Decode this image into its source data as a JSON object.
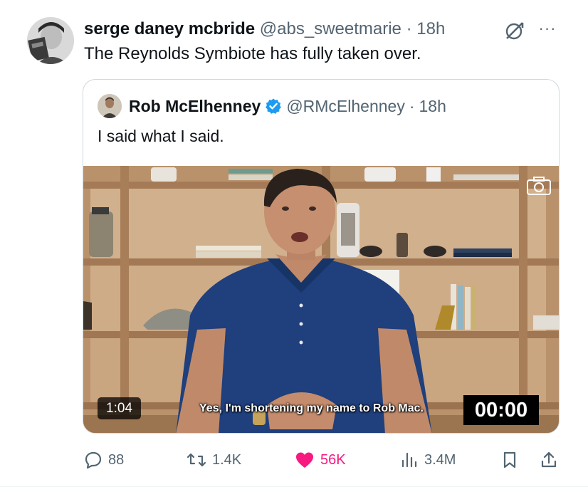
{
  "tweet": {
    "display_name": "serge daney mcbride",
    "handle": "@abs_sweetmarie",
    "separator": "·",
    "time": "18h",
    "text": "The Reynolds Symbiote has fully taken over.",
    "more_label": "···"
  },
  "quote": {
    "display_name": "Rob McElhenney",
    "handle": "@RMcElhenney",
    "separator": "·",
    "time": "18h",
    "text": "I said what I said.",
    "verified_color": "#1d9bf0"
  },
  "video": {
    "duration": "1:04",
    "subtitle": "Yes, I'm shortening my name to Rob Mac.",
    "timecode": "00:00"
  },
  "actions": {
    "replies": "88",
    "reposts": "1.4K",
    "likes": "56K",
    "views": "3.4M",
    "like_color": "#f91880",
    "icon_color": "#536471"
  }
}
